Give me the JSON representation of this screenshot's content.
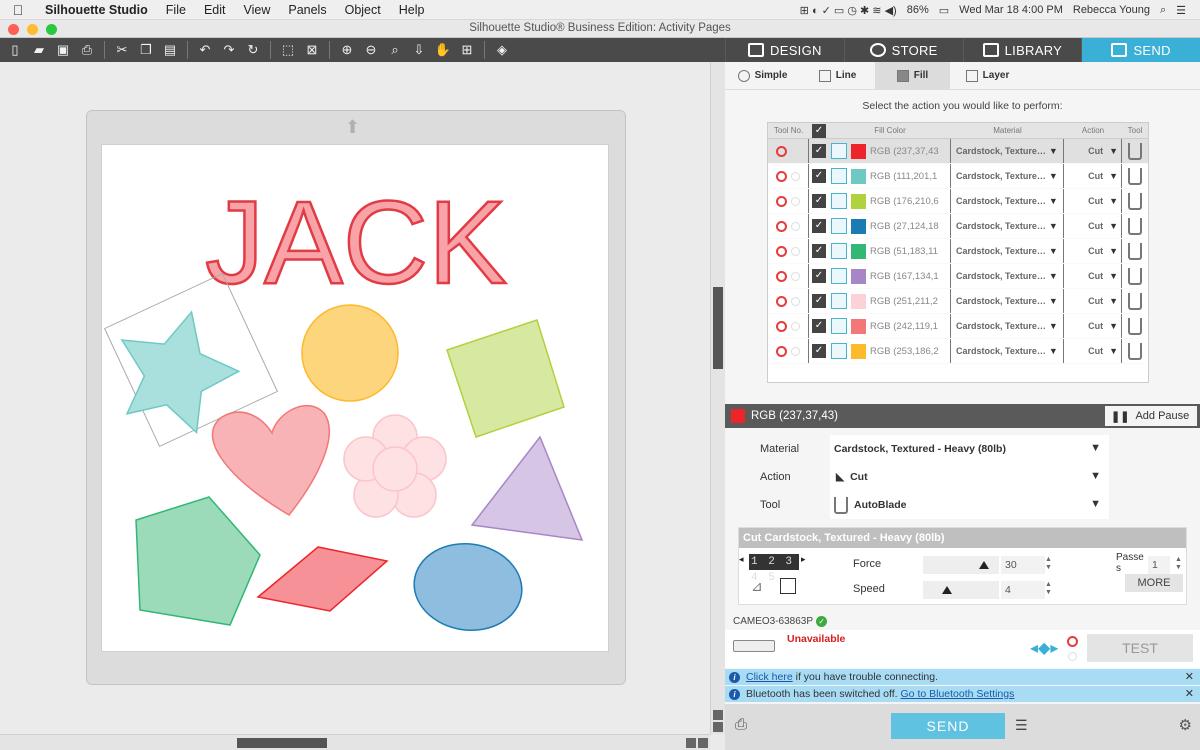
{
  "menubar": {
    "app": "Silhouette Studio",
    "items": [
      "File",
      "Edit",
      "View",
      "Panels",
      "Object",
      "Help"
    ],
    "battery": "86%",
    "datetime": "Wed Mar 18  4:00 PM",
    "user": "Rebecca Young"
  },
  "window": {
    "title": "Silhouette Studio® Business Edition: Activity Pages"
  },
  "nav_tabs": [
    {
      "label": "DESIGN",
      "icon": "grid-icon"
    },
    {
      "label": "STORE",
      "icon": "store-icon"
    },
    {
      "label": "LIBRARY",
      "icon": "library-icon"
    },
    {
      "label": "SEND",
      "icon": "send-icon"
    }
  ],
  "colors": {
    "accent": "#3ab0d6",
    "toolbar": "#4a4a4a",
    "error": "#d42020"
  },
  "canvas": {
    "title_text": "JACK"
  },
  "mode_tabs": [
    "Simple",
    "Line",
    "Fill",
    "Layer"
  ],
  "prompt": "Select the action you would like to perform:",
  "table": {
    "headers": [
      "Tool No.",
      "Fill Color",
      "Material",
      "Action",
      "Tool"
    ],
    "rows": [
      {
        "color": "#ed252b",
        "rgb": "RGB (237,37,43",
        "material": "Cardstock, Texture…",
        "action": "Cut"
      },
      {
        "color": "#6fc9c3",
        "rgb": "RGB (111,201,1",
        "material": "Cardstock, Texture…",
        "action": "Cut"
      },
      {
        "color": "#b0d23e",
        "rgb": "RGB (176,210,6",
        "material": "Cardstock, Texture…",
        "action": "Cut"
      },
      {
        "color": "#1b7cb4",
        "rgb": "RGB (27,124,18",
        "material": "Cardstock, Texture…",
        "action": "Cut"
      },
      {
        "color": "#33b774",
        "rgb": "RGB (51,183,11",
        "material": "Cardstock, Texture…",
        "action": "Cut"
      },
      {
        "color": "#a786c8",
        "rgb": "RGB (167,134,1",
        "material": "Cardstock, Texture…",
        "action": "Cut"
      },
      {
        "color": "#fbd3d6",
        "rgb": "RGB (251,211,2",
        "material": "Cardstock, Texture…",
        "action": "Cut"
      },
      {
        "color": "#f27777",
        "rgb": "RGB (242,119,1",
        "material": "Cardstock, Texture…",
        "action": "Cut"
      },
      {
        "color": "#fdba2c",
        "rgb": "RGB (253,186,2",
        "material": "Cardstock, Texture…",
        "action": "Cut"
      }
    ]
  },
  "selected": {
    "rgb": "RGB (237,37,43)",
    "add_pause": "Add Pause"
  },
  "props": {
    "material_label": "Material",
    "material_value": "Cardstock, Textured - Heavy (80lb)",
    "action_label": "Action",
    "action_value": "Cut",
    "tool_label": "Tool",
    "tool_value": "AutoBlade"
  },
  "cut_settings": {
    "header": "Cut Cardstock, Textured - Heavy (80lb)",
    "blade_digits": "1 2 3 4 5",
    "force_label": "Force",
    "force_value": "30",
    "speed_label": "Speed",
    "speed_value": "4",
    "passes_label": "Passe\ns",
    "passes_value": "1",
    "more_label": "MORE"
  },
  "device": {
    "name": "CAMEO3-63863P",
    "status": "Unavailable",
    "test_label": "TEST"
  },
  "info": {
    "line1_link": "Click here",
    "line1_text": " if you have trouble connecting.",
    "line2_text": "Bluetooth has been switched off.",
    "line2_link": "Go to Bluetooth Settings"
  },
  "send_label": "SEND"
}
